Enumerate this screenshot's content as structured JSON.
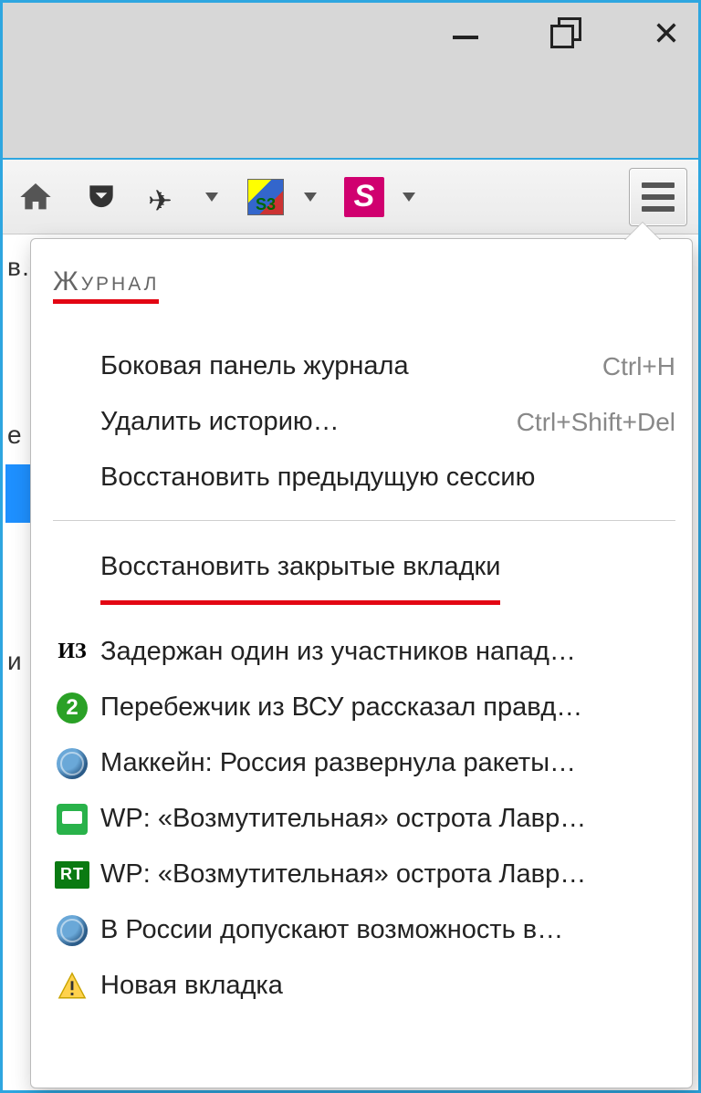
{
  "window": {
    "controls": {
      "min": "minimize",
      "max": "maximize",
      "close": "close"
    }
  },
  "toolbar": {
    "home": "home",
    "pocket": "pocket",
    "s3": "S3",
    "bigS": "S"
  },
  "left_sliver": {
    "rows": [
      "в…",
      "",
      "е",
      "",
      "",
      "и"
    ]
  },
  "panel": {
    "heading": "Журнал",
    "actions": [
      {
        "label": "Боковая панель журнала",
        "shortcut": "Ctrl+H"
      },
      {
        "label": "Удалить историю…",
        "shortcut": "Ctrl+Shift+Del"
      },
      {
        "label": "Восстановить предыдущую сессию",
        "shortcut": ""
      }
    ],
    "closed_tabs_heading": "Восстановить закрытые вкладки",
    "closed_tabs": [
      {
        "icon": "iz",
        "label": "Задержан один из участников напад…"
      },
      {
        "icon": "two",
        "label": "Перебежчик из ВСУ рассказал правд…"
      },
      {
        "icon": "globe",
        "label": "Маккейн: Россия развернула ракеты…"
      },
      {
        "icon": "wp",
        "label": "WP: «Возмутительная» острота Лавр…"
      },
      {
        "icon": "rt",
        "label": "WP: «Возмутительная» острота Лавр…"
      },
      {
        "icon": "globe",
        "label": "В России допускают возможность в…"
      },
      {
        "icon": "warn",
        "label": "Новая вкладка"
      }
    ]
  }
}
